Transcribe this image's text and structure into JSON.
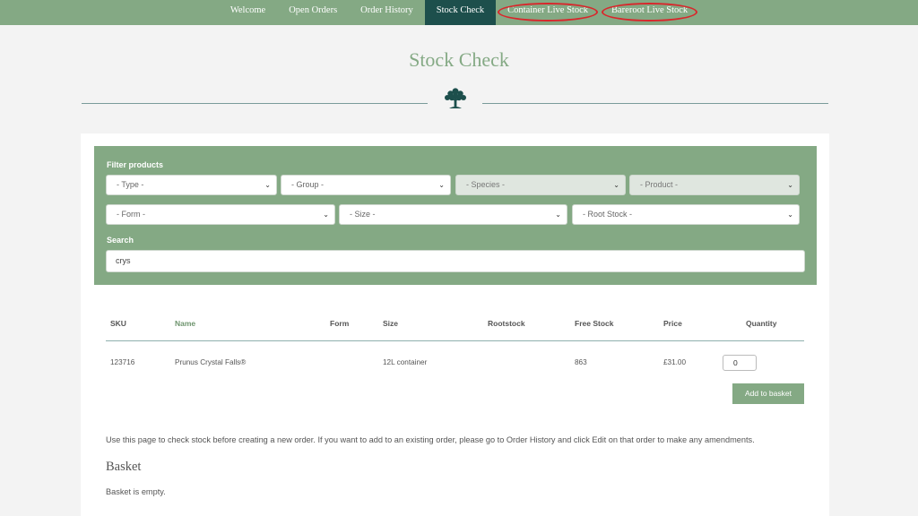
{
  "nav": {
    "items": [
      {
        "label": "Welcome"
      },
      {
        "label": "Open Orders"
      },
      {
        "label": "Order History"
      },
      {
        "label": "Stock Check"
      },
      {
        "label": "Container Live Stock"
      },
      {
        "label": "Bareroot Live Stock"
      }
    ],
    "active_index": 3,
    "highlighted_color": "#d9262b"
  },
  "page": {
    "title": "Stock Check",
    "divider_icon": "tree-icon"
  },
  "filters": {
    "label": "Filter products",
    "type": "- Type -",
    "group": "- Group -",
    "species": "- Species -",
    "product": "- Product -",
    "form": "- Form -",
    "size": "- Size -",
    "root_stock": "- Root Stock -",
    "search_label": "Search",
    "search_value": "crys"
  },
  "table": {
    "headers": {
      "sku": "SKU",
      "name": "Name",
      "form": "Form",
      "size": "Size",
      "rootstock": "Rootstock",
      "free_stock": "Free Stock",
      "price": "Price",
      "quantity": "Quantity"
    },
    "rows": [
      {
        "sku": "123716",
        "name": "Prunus Crystal Falls®",
        "form": "",
        "size": "12L container",
        "rootstock": "",
        "free_stock": "863",
        "price": "£31.00",
        "quantity": "0"
      }
    ],
    "add_button": "Add to basket"
  },
  "info_text": "Use this page to check stock before creating a new order. If you want to add to an existing order, please go to Order History and click Edit on that order to make any amendments.",
  "basket": {
    "title": "Basket",
    "status": "Basket is empty."
  },
  "colors": {
    "nav_bg": "#84a984",
    "nav_active": "#1d4f4c",
    "accent": "#84a984",
    "page_bg": "#f3f3f3"
  }
}
